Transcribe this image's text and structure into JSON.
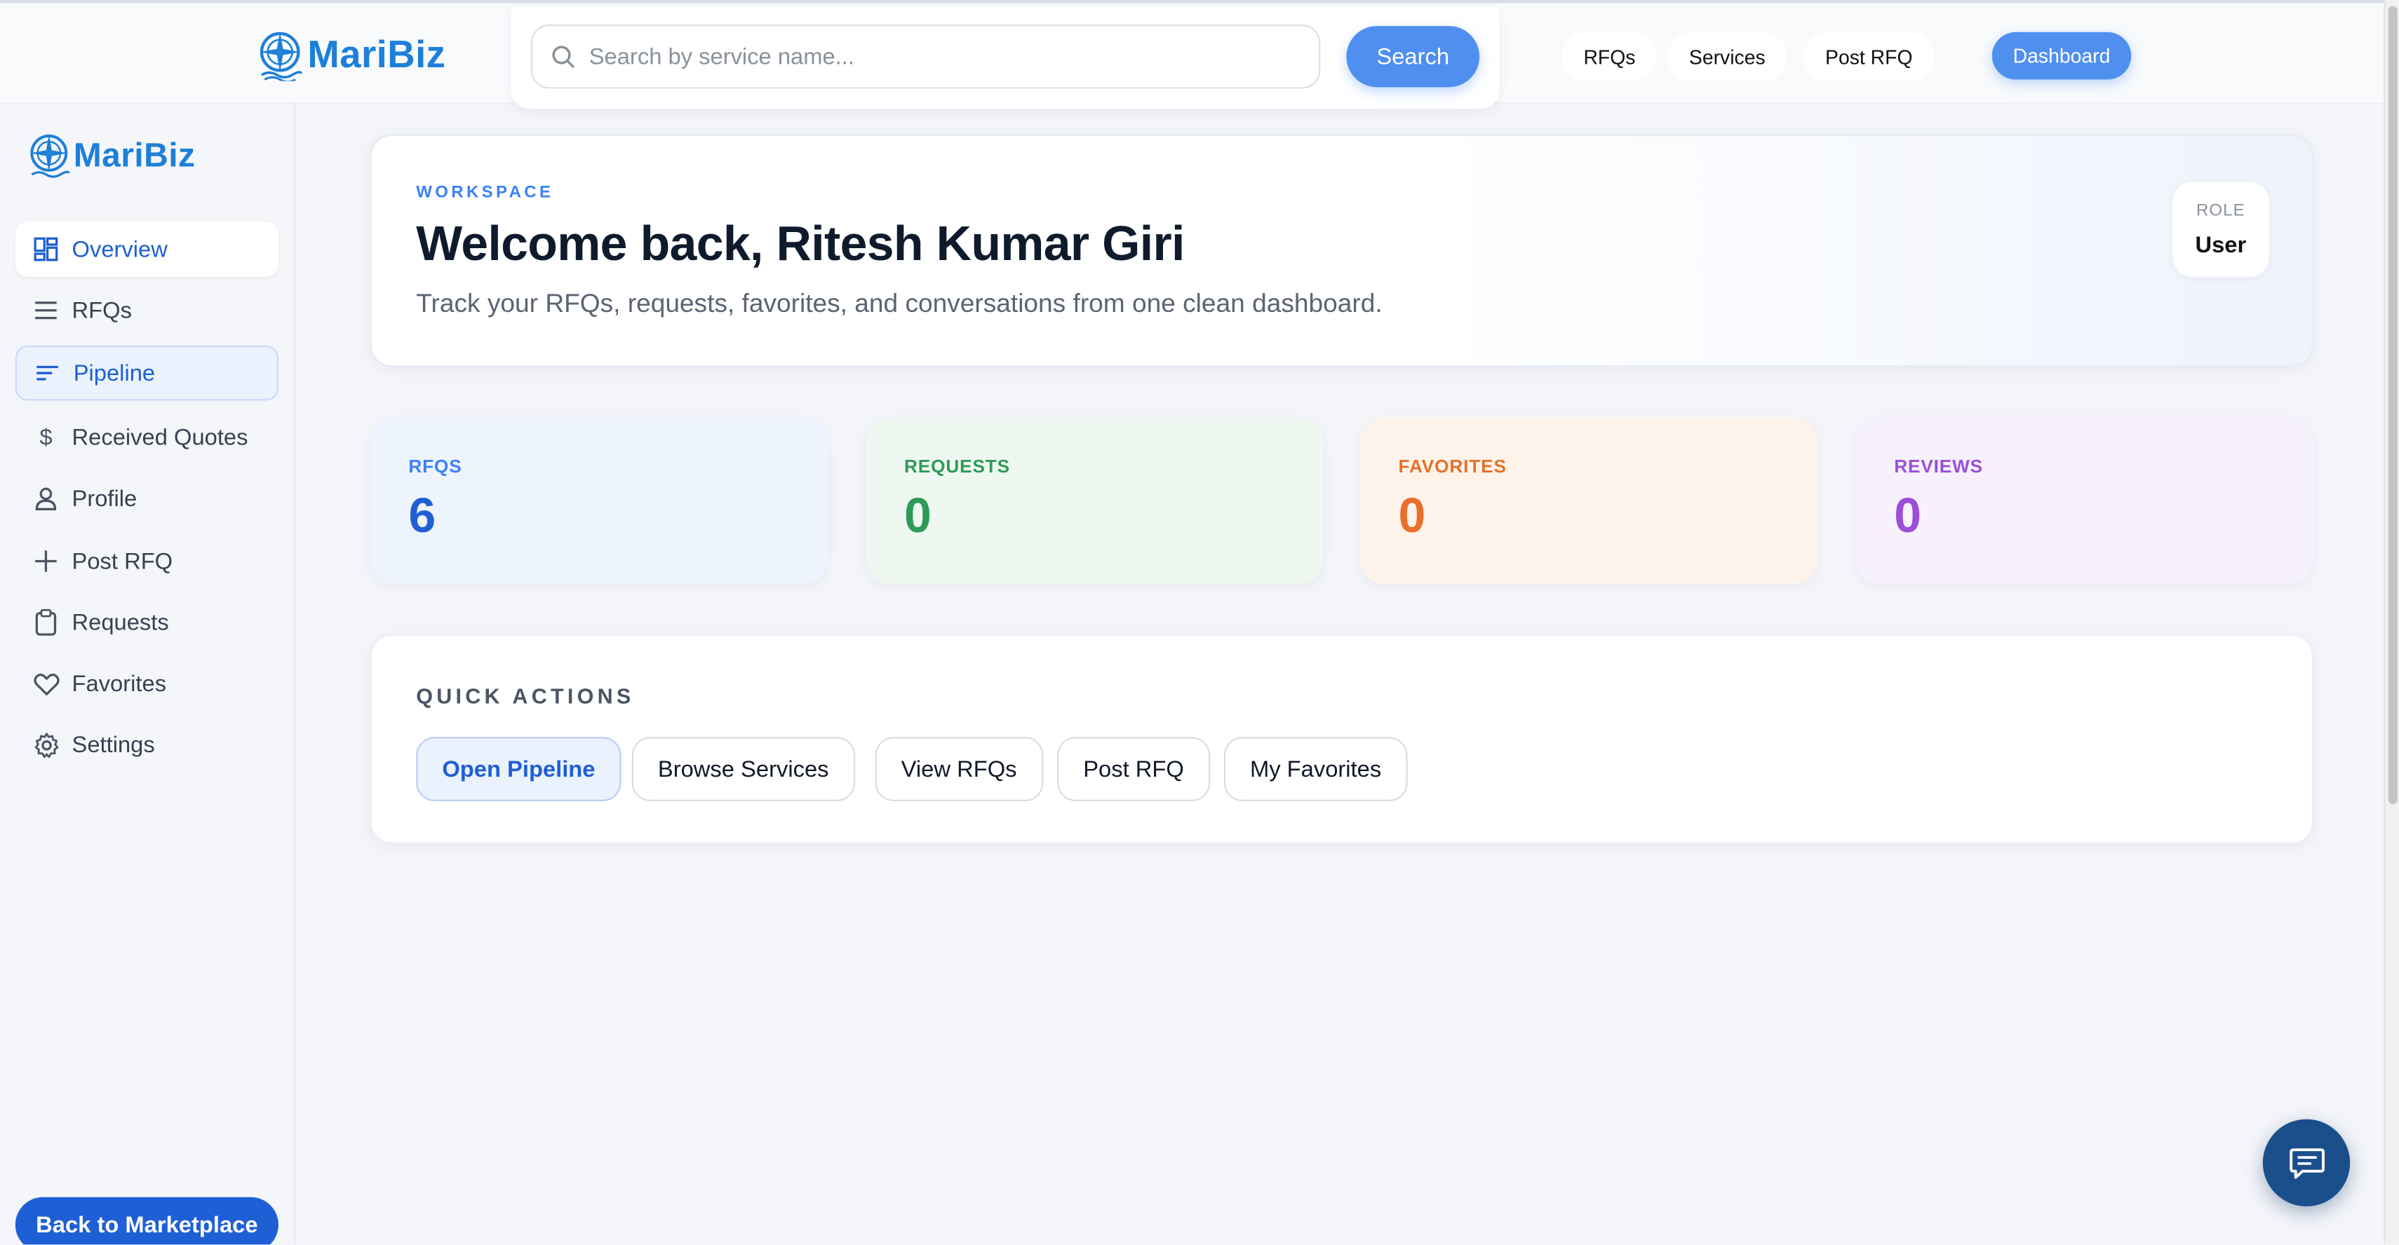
{
  "brand": {
    "name": "MariBiz",
    "accent": "#1e7fd8"
  },
  "topbar": {
    "search_placeholder": "Search by service name...",
    "search_button": "Search",
    "nav": [
      "RFQs",
      "Services",
      "Post RFQ"
    ],
    "dashboard_button": "Dashboard"
  },
  "sidebar": {
    "items": [
      {
        "label": "Overview",
        "icon": "grid-icon"
      },
      {
        "label": "RFQs",
        "icon": "list-icon"
      },
      {
        "label": "Pipeline",
        "icon": "pipeline-icon"
      },
      {
        "label": "Received Quotes",
        "icon": "dollar-icon"
      },
      {
        "label": "Profile",
        "icon": "user-icon"
      },
      {
        "label": "Post RFQ",
        "icon": "plus-icon"
      },
      {
        "label": "Requests",
        "icon": "clipboard-icon"
      },
      {
        "label": "Favorites",
        "icon": "heart-icon"
      },
      {
        "label": "Settings",
        "icon": "gear-icon"
      }
    ],
    "back_button": "Back to Marketplace"
  },
  "welcome": {
    "eyebrow": "WORKSPACE",
    "title": "Welcome back, Ritesh Kumar Giri",
    "subtitle": "Track your RFQs, requests, favorites, and conversations from one clean dashboard.",
    "role_label": "ROLE",
    "role_value": "User"
  },
  "stats": [
    {
      "label": "RFQS",
      "value": "6",
      "color": "#1f5fd6",
      "bg": "#eef4fd"
    },
    {
      "label": "REQUESTS",
      "value": "0",
      "color": "#2e9a57",
      "bg": "#eef8f1"
    },
    {
      "label": "FAVORITES",
      "value": "0",
      "color": "#e8702a",
      "bg": "#fdf3ea"
    },
    {
      "label": "REVIEWS",
      "value": "0",
      "color": "#9b4fd9",
      "bg": "#f6f1fc"
    }
  ],
  "quick_actions": {
    "label": "QUICK ACTIONS",
    "buttons": [
      "Open Pipeline",
      "Browse Services",
      "View RFQs",
      "Post RFQ",
      "My Favorites"
    ]
  }
}
